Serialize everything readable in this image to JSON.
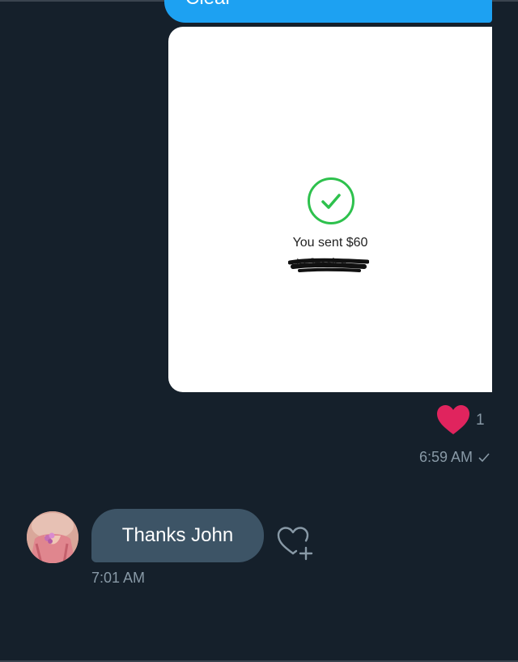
{
  "conversation": {
    "outgoing_text_partial": "Clear",
    "attachment": {
      "payment_text": "You sent $60",
      "redacted_text": "to Jessica"
    },
    "reaction": {
      "icon": "heart-icon",
      "color": "#e0245e",
      "count": "1"
    },
    "outgoing_time": "6:59 AM",
    "read_icon": "check-icon",
    "incoming": {
      "text": "Thanks John",
      "time": "7:01 AM"
    },
    "like_icon": "heart-plus-icon"
  },
  "colors": {
    "background": "#15202b",
    "outgoing_bubble": "#1da1f2",
    "incoming_bubble": "#3d5466",
    "secondary_text": "#8899a6",
    "success_green": "#2ec14d"
  }
}
